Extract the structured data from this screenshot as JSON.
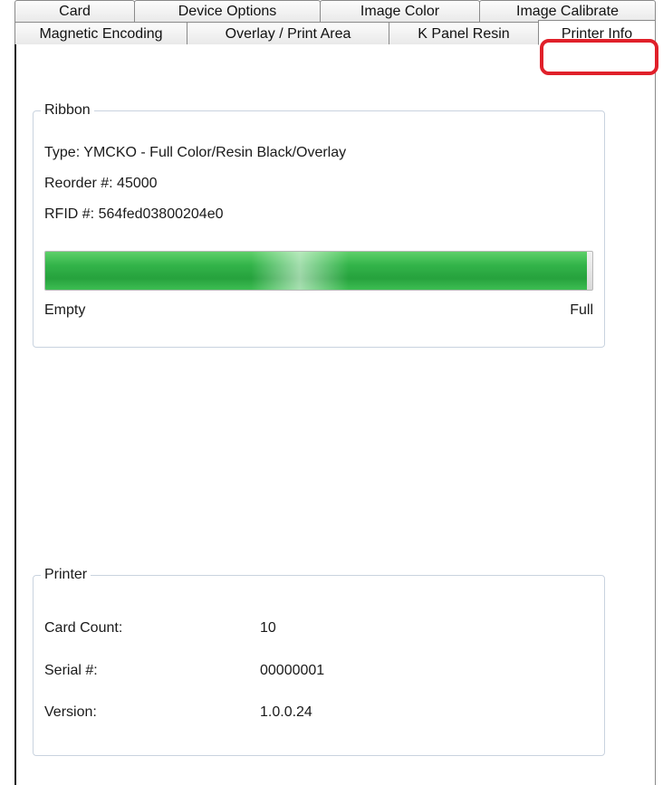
{
  "tabs": {
    "back_row": [
      "Card",
      "Device Options",
      "Image Color",
      "Image Calibrate"
    ],
    "front_row": [
      "Magnetic Encoding",
      "Overlay / Print Area",
      "K Panel Resin",
      "Printer Info"
    ],
    "active": "Printer Info"
  },
  "ribbon": {
    "legend": "Ribbon",
    "type_line": "Type: YMCKO - Full Color/Resin Black/Overlay",
    "reorder_line": "Reorder #: 45000",
    "rfid_line": "RFID #: 564fed03800204e0",
    "level_fraction": 0.99,
    "empty_label": "Empty",
    "full_label": "Full"
  },
  "printer": {
    "legend": "Printer",
    "card_count_label": "Card Count:",
    "card_count_value": "10",
    "serial_label": "Serial #:",
    "serial_value": "00000001",
    "version_label": "Version:",
    "version_value": "1.0.0.24"
  },
  "colors": {
    "highlight": "#e0202a",
    "progress_fill": "#33b44a",
    "group_border": "#c9d3df"
  }
}
